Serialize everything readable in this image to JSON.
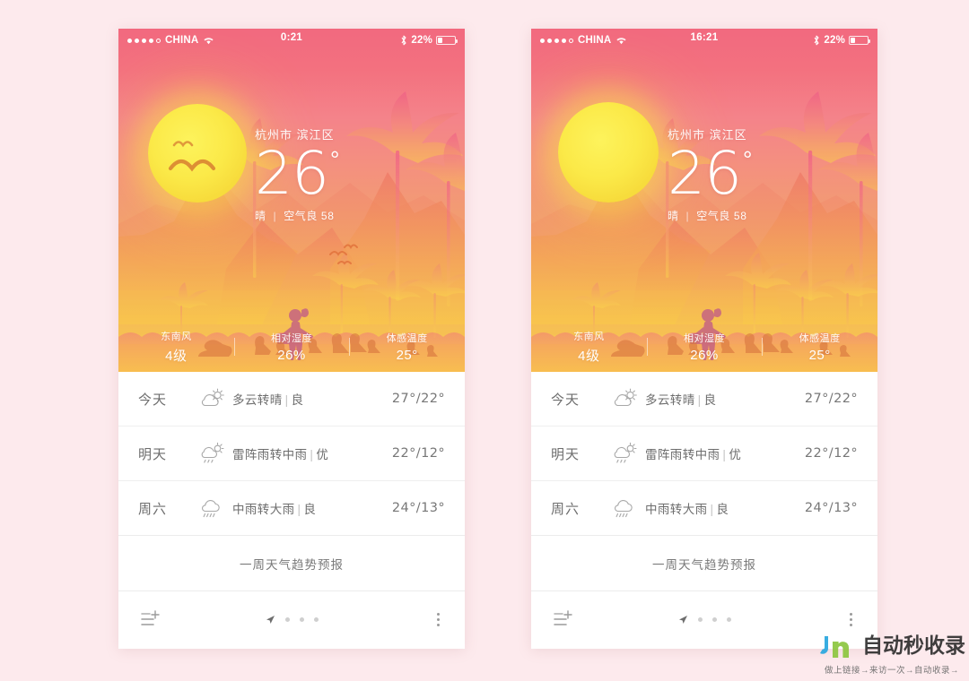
{
  "meta": {
    "page_background": "#fdeaed",
    "accent_pink": "#f2697f",
    "accent_yellow": "#fbd84a"
  },
  "phones": [
    {
      "id": "phone-left",
      "status_bar": {
        "signal_dots_total": 5,
        "signal_dots_filled": 4,
        "carrier": "CHINA",
        "wifi_icon": "wifi-icon",
        "time": "0:21",
        "bluetooth_icon": "bluetooth-icon",
        "battery_percent": "22%",
        "battery_level": 22
      },
      "hero": {
        "sun_icon": "sun-icon",
        "birds_icon": "birds-icon",
        "show_sun_birds": true,
        "show_sky_birds": true,
        "location": "杭州市 滨江区",
        "temperature": "26",
        "degree": "°",
        "condition": "晴",
        "separator": "|",
        "air_quality": "空气良 58"
      },
      "stats": [
        {
          "key": "东南风",
          "value": "4级"
        },
        {
          "key": "相对湿度",
          "value": "26%"
        },
        {
          "key": "体感温度",
          "value": "25°"
        }
      ],
      "forecast": [
        {
          "day": "今天",
          "icon": "partly-cloudy-icon",
          "desc": "多云转晴",
          "sep": "|",
          "aqi": "良",
          "temps": "27°/22°"
        },
        {
          "day": "明天",
          "icon": "thunderstorm-icon",
          "desc": "雷阵雨转中雨",
          "sep": "|",
          "aqi": "优",
          "temps": "22°/12°"
        },
        {
          "day": "周六",
          "icon": "rain-icon",
          "desc": "中雨转大雨",
          "sep": "|",
          "aqi": "良",
          "temps": "24°/13°"
        }
      ],
      "trend_label": "一周天气趋势预报",
      "bottom": {
        "add_city_icon": "add-list-icon",
        "pages_total": 4,
        "current_page_icon": "location-arrow-icon",
        "more_icon": "more-vertical-icon"
      }
    },
    {
      "id": "phone-right",
      "status_bar": {
        "signal_dots_total": 5,
        "signal_dots_filled": 4,
        "carrier": "CHINA",
        "wifi_icon": "wifi-icon",
        "time": "16:21",
        "bluetooth_icon": "bluetooth-icon",
        "battery_percent": "22%",
        "battery_level": 22
      },
      "hero": {
        "sun_icon": "sun-icon",
        "birds_icon": "birds-icon",
        "show_sun_birds": false,
        "show_sky_birds": false,
        "location": "杭州市 滨江区",
        "temperature": "26",
        "degree": "°",
        "condition": "晴",
        "separator": "|",
        "air_quality": "空气良 58"
      },
      "stats": [
        {
          "key": "东南风",
          "value": "4级"
        },
        {
          "key": "相对湿度",
          "value": "26%"
        },
        {
          "key": "体感温度",
          "value": "25°"
        }
      ],
      "forecast": [
        {
          "day": "今天",
          "icon": "partly-cloudy-icon",
          "desc": "多云转晴",
          "sep": "|",
          "aqi": "良",
          "temps": "27°/22°"
        },
        {
          "day": "明天",
          "icon": "thunderstorm-icon",
          "desc": "雷阵雨转中雨",
          "sep": "|",
          "aqi": "优",
          "temps": "22°/12°"
        },
        {
          "day": "周六",
          "icon": "rain-icon",
          "desc": "中雨转大雨",
          "sep": "|",
          "aqi": "良",
          "temps": "24°/13°"
        }
      ],
      "trend_label": "一周天气趋势预报",
      "bottom": {
        "add_city_icon": "add-list-icon",
        "pages_total": 4,
        "current_page_icon": "location-arrow-icon",
        "more_icon": "more-vertical-icon"
      }
    }
  ],
  "watermark": {
    "logo_icon": "jr-logo-icon",
    "title": "自动秒收录",
    "subtitle": "做上链接→来访一次→自动收录→"
  }
}
